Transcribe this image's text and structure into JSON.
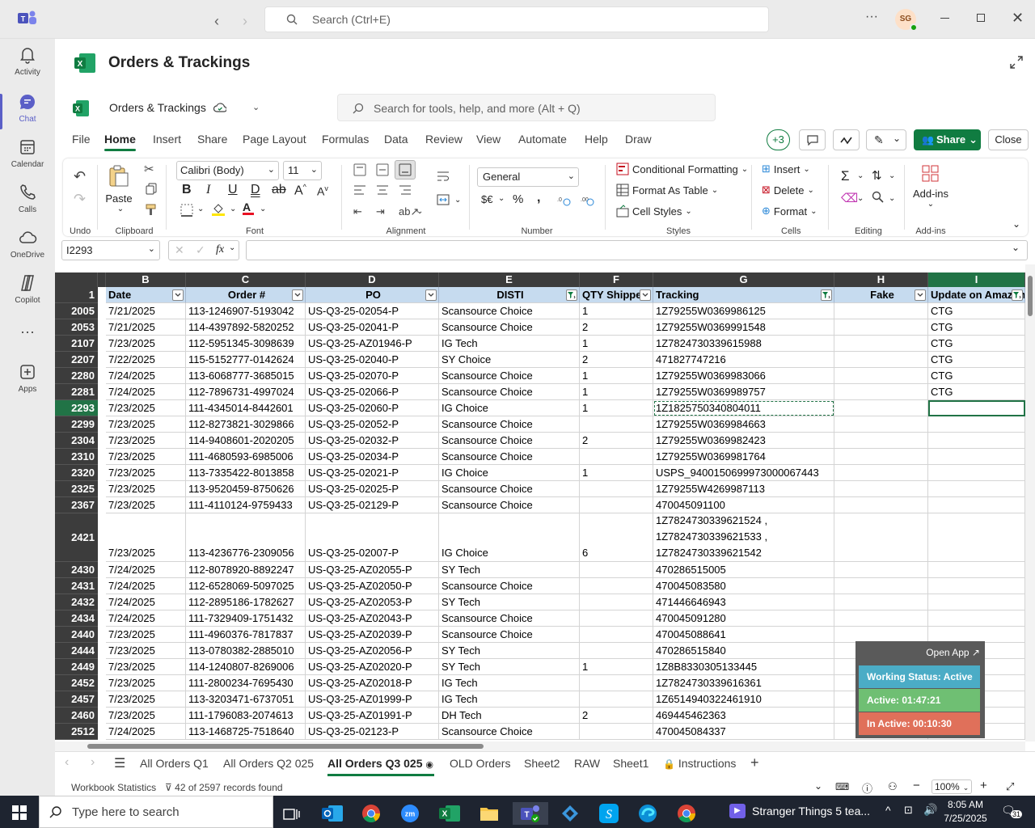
{
  "teams": {
    "search_placeholder": "Search (Ctrl+E)",
    "avatar_initials": "SG",
    "rail": [
      {
        "label": "Activity",
        "icon": "bell-icon"
      },
      {
        "label": "Chat",
        "icon": "chat-icon"
      },
      {
        "label": "Calendar",
        "icon": "calendar-icon"
      },
      {
        "label": "Calls",
        "icon": "phone-icon"
      },
      {
        "label": "OneDrive",
        "icon": "cloud-icon"
      },
      {
        "label": "Copilot",
        "icon": "copilot-icon"
      },
      {
        "label": "Apps",
        "icon": "add-app-icon"
      }
    ],
    "accent": "#5b5fc7"
  },
  "doc": {
    "title": "Orders & Trackings",
    "file_name": "Orders & Trackings",
    "search_placeholder": "Search for tools, help, and more (Alt + Q)"
  },
  "menu": {
    "tabs": [
      "File",
      "Home",
      "Insert",
      "Share",
      "Page Layout",
      "Formulas",
      "Data",
      "Review",
      "View",
      "Automate",
      "Help",
      "Draw"
    ],
    "plus": "+3",
    "share": "Share",
    "close": "Close"
  },
  "ribbon": {
    "undo_label": "Undo",
    "clipboard_label": "Clipboard",
    "paste": "Paste",
    "font_label": "Font",
    "font_name": "Calibri (Body)",
    "font_size": "11",
    "alignment_label": "Alignment",
    "number_label": "Number",
    "number_format": "General",
    "currency": "$€",
    "styles_label": "Styles",
    "cond_format": "Conditional Formatting",
    "format_table": "Format As Table",
    "cell_styles": "Cell Styles",
    "cells_label": "Cells",
    "insert": "Insert",
    "delete": "Delete",
    "format": "Format",
    "editing_label": "Editing",
    "addins": "Add-ins",
    "addins_label": "Add-ins"
  },
  "formula_bar": {
    "name_box": "I2293",
    "fx": "fx",
    "value": ""
  },
  "grid": {
    "columns": [
      {
        "letter": "B",
        "header": "Date"
      },
      {
        "letter": "C",
        "header": "Order #"
      },
      {
        "letter": "D",
        "header": "PO"
      },
      {
        "letter": "E",
        "header": "DISTI"
      },
      {
        "letter": "F",
        "header": "QTY Shipped"
      },
      {
        "letter": "G",
        "header": "Tracking"
      },
      {
        "letter": "H",
        "header": "Fake"
      },
      {
        "letter": "I",
        "header": "Update on Amazon"
      }
    ],
    "header_row": "1",
    "rows": [
      {
        "r": "2005",
        "c": [
          "7/21/2025",
          "113-1246907-5193042",
          "US-Q3-25-02054-P",
          "Scansource Choice",
          "1",
          "1Z79255W0369986125",
          "",
          "CTG"
        ]
      },
      {
        "r": "2053",
        "c": [
          "7/21/2025",
          "114-4397892-5820252",
          "US-Q3-25-02041-P",
          "Scansource Choice",
          "2",
          "1Z79255W0369991548",
          "",
          "CTG"
        ]
      },
      {
        "r": "2107",
        "c": [
          "7/23/2025",
          "112-5951345-3098639",
          "US-Q3-25-AZ01946-P",
          "IG Tech",
          "1",
          "1Z7824730339615988",
          "",
          "CTG"
        ]
      },
      {
        "r": "2207",
        "c": [
          "7/22/2025",
          "115-5152777-0142624",
          "US-Q3-25-02040-P",
          "SY Choice",
          "2",
          "471827747216",
          "",
          "CTG"
        ]
      },
      {
        "r": "2280",
        "c": [
          "7/24/2025",
          "113-6068777-3685015",
          "US-Q3-25-02070-P",
          "Scansource Choice",
          "1",
          "1Z79255W0369983066",
          "",
          "CTG"
        ]
      },
      {
        "r": "2281",
        "c": [
          "7/24/2025",
          "112-7896731-4997024",
          "US-Q3-25-02066-P",
          "Scansource Choice",
          "1",
          "1Z79255W0369989757",
          "",
          "CTG"
        ]
      },
      {
        "r": "2293",
        "c": [
          "7/23/2025",
          "111-4345014-8442601",
          "US-Q3-25-02060-P",
          "IG Choice",
          "1",
          "1Z1825750340804011",
          "",
          ""
        ]
      },
      {
        "r": "2299",
        "c": [
          "7/23/2025",
          "112-8273821-3029866",
          "US-Q3-25-02052-P",
          "Scansource Choice",
          "",
          "1Z79255W0369984663",
          "",
          ""
        ]
      },
      {
        "r": "2304",
        "c": [
          "7/23/2025",
          "114-9408601-2020205",
          "US-Q3-25-02032-P",
          "Scansource Choice",
          "2",
          "1Z79255W0369982423",
          "",
          ""
        ]
      },
      {
        "r": "2310",
        "c": [
          "7/23/2025",
          "111-4680593-6985006",
          "US-Q3-25-02034-P",
          "Scansource Choice",
          "",
          "1Z79255W0369981764",
          "",
          ""
        ]
      },
      {
        "r": "2320",
        "c": [
          "7/23/2025",
          "113-7335422-8013858",
          "US-Q3-25-02021-P",
          "IG Choice",
          "1",
          "USPS_9400150699973000067443",
          "",
          ""
        ]
      },
      {
        "r": "2325",
        "c": [
          "7/23/2025",
          "113-9520459-8750626",
          "US-Q3-25-02025-P",
          "Scansource Choice",
          "",
          "1Z79255W4269987113",
          "",
          ""
        ]
      },
      {
        "r": "2367",
        "c": [
          "7/23/2025",
          "111-4110124-9759433",
          "US-Q3-25-02129-P",
          "Scansource Choice",
          "",
          "470045091100",
          "",
          ""
        ]
      },
      {
        "r": "2421",
        "tall": true,
        "c": [
          "7/23/2025",
          "113-4236776-2309056",
          "US-Q3-25-02007-P",
          "IG Choice",
          "6",
          "1Z7824730339621524 ,\n1Z7824730339621533 ,\n1Z7824730339621542",
          "",
          ""
        ]
      },
      {
        "r": "2430",
        "c": [
          "7/24/2025",
          "112-8078920-8892247",
          "US-Q3-25-AZ02055-P",
          "SY Tech",
          "",
          "470286515005",
          "",
          ""
        ]
      },
      {
        "r": "2431",
        "c": [
          "7/24/2025",
          "112-6528069-5097025",
          "US-Q3-25-AZ02050-P",
          "Scansource Choice",
          "",
          "470045083580",
          "",
          ""
        ]
      },
      {
        "r": "2432",
        "c": [
          "7/24/2025",
          "112-2895186-1782627",
          "US-Q3-25-AZ02053-P",
          "SY Tech",
          "",
          "471446646943",
          "",
          ""
        ]
      },
      {
        "r": "2434",
        "c": [
          "7/24/2025",
          "111-7329409-1751432",
          "US-Q3-25-AZ02043-P",
          "Scansource Choice",
          "",
          "470045091280",
          "",
          ""
        ]
      },
      {
        "r": "2440",
        "c": [
          "7/23/2025",
          "111-4960376-7817837",
          "US-Q3-25-AZ02039-P",
          "Scansource Choice",
          "",
          "470045088641",
          "",
          ""
        ]
      },
      {
        "r": "2444",
        "c": [
          "7/23/2025",
          "113-0780382-2885010",
          "US-Q3-25-AZ02056-P",
          "SY Tech",
          "",
          "470286515840",
          "",
          ""
        ]
      },
      {
        "r": "2449",
        "c": [
          "7/23/2025",
          "114-1240807-8269006",
          "US-Q3-25-AZ02020-P",
          "SY Tech",
          "1",
          "1Z8B8330305133445",
          "",
          ""
        ]
      },
      {
        "r": "2452",
        "c": [
          "7/23/2025",
          "111-2800234-7695430",
          "US-Q3-25-AZ02018-P",
          "IG Tech",
          "",
          "1Z7824730339616361",
          "",
          ""
        ]
      },
      {
        "r": "2457",
        "c": [
          "7/23/2025",
          "113-3203471-6737051",
          "US-Q3-25-AZ01999-P",
          "IG Tech",
          "",
          "1Z6514940322461910",
          "",
          ""
        ]
      },
      {
        "r": "2460",
        "c": [
          "7/23/2025",
          "111-1796083-2074613",
          "US-Q3-25-AZ01991-P",
          "DH Tech",
          "2",
          "469445462363",
          "",
          ""
        ]
      },
      {
        "r": "2512",
        "c": [
          "7/24/2025",
          "113-1468725-7518640",
          "US-Q3-25-02123-P",
          "Scansource Choice",
          "",
          "470045084337",
          "",
          ""
        ]
      }
    ]
  },
  "overlay": {
    "open_app": "Open App ↗",
    "status": "Working Status: Active",
    "active": "Active: 01:47:21",
    "inactive": "In Active: 00:10:30"
  },
  "sheets": [
    "All Orders Q1",
    "All Orders Q2 025",
    "All Orders Q3 025",
    "OLD Orders",
    "Sheet2",
    "RAW",
    "Sheet1",
    "Instructions"
  ],
  "status_bar": {
    "stats": "Workbook Statistics",
    "filter": "42 of 2597 records found",
    "zoom": "100%"
  },
  "taskbar": {
    "search_placeholder": "Type here to search",
    "media": "Stranger Things 5 tea...",
    "time": "8:05 AM",
    "date": "7/25/2025",
    "notif": "31"
  }
}
